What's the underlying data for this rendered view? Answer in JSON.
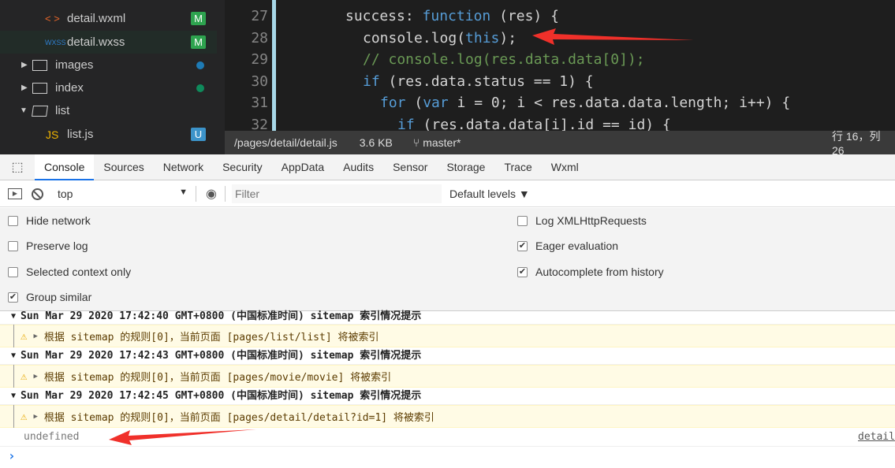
{
  "tree": {
    "items": [
      {
        "label": "detail.wxml",
        "icon": "xml-icon",
        "badge": "M",
        "badge_color": "#2ea34f"
      },
      {
        "label": "detail.wxss",
        "icon": "wxss-icon",
        "badge": "M",
        "badge_color": "#2ea34f"
      },
      {
        "label": "images",
        "icon": "folder-icon",
        "dot_color": "#1e7bb5"
      },
      {
        "label": "index",
        "icon": "folder-icon",
        "dot_color": "#0f8a5b"
      },
      {
        "label": "list",
        "icon": "folder-open-icon"
      },
      {
        "label": "list.js",
        "icon": "js-icon",
        "badge": "U",
        "badge_color": "#3c93c9"
      }
    ]
  },
  "editor": {
    "lines": [
      {
        "n": "27",
        "code": "success: function (res) {"
      },
      {
        "n": "28",
        "code": "console.log(this);"
      },
      {
        "n": "29",
        "code": "// console.log(res.data.data[0]);"
      },
      {
        "n": "30",
        "code": "if (res.data.status == 1) {"
      },
      {
        "n": "31",
        "code": "for (var i = 0; i < res.data.data.length; i++) {"
      },
      {
        "n": "32",
        "code": "if (res.data.data[i].id == id) {"
      }
    ]
  },
  "status": {
    "path": "/pages/detail/detail.js",
    "size": "3.6 KB",
    "branch": "master*",
    "position": "行 16，列 26"
  },
  "tabs": [
    "Console",
    "Sources",
    "Network",
    "Security",
    "AppData",
    "Audits",
    "Sensor",
    "Storage",
    "Trace",
    "Wxml"
  ],
  "toolbar": {
    "context": "top",
    "filter_placeholder": "Filter",
    "levels": "Default levels ▼"
  },
  "settings": {
    "left": [
      {
        "label": "Hide network",
        "checked": false
      },
      {
        "label": "Preserve log",
        "checked": false
      },
      {
        "label": "Selected context only",
        "checked": false
      },
      {
        "label": "Group similar",
        "checked": true
      }
    ],
    "right": [
      {
        "label": "Log XMLHttpRequests",
        "checked": false
      },
      {
        "label": "Eager evaluation",
        "checked": true
      },
      {
        "label": "Autocomplete from history",
        "checked": true
      }
    ]
  },
  "console": {
    "groups": [
      {
        "header": "Sun Mar 29 2020 17:42:40 GMT+0800 (中国标准时间) sitemap 索引情况提示",
        "warning": "根据 sitemap 的规则[0]，当前页面 [pages/list/list] 将被索引"
      },
      {
        "header": "Sun Mar 29 2020 17:42:43 GMT+0800 (中国标准时间) sitemap 索引情况提示",
        "warning": "根据 sitemap 的规则[0]，当前页面 [pages/movie/movie] 将被索引"
      },
      {
        "header": "Sun Mar 29 2020 17:42:45 GMT+0800 (中国标准时间) sitemap 索引情况提示",
        "warning": "根据 sitemap 的规则[0]，当前页面 [pages/detail/detail?id=1] 将被索引"
      }
    ],
    "output": "undefined",
    "source": "detail",
    "prompt": "›"
  },
  "colors": {
    "accent": "#1a73e8",
    "annotation_arrow": "#f0302a"
  }
}
